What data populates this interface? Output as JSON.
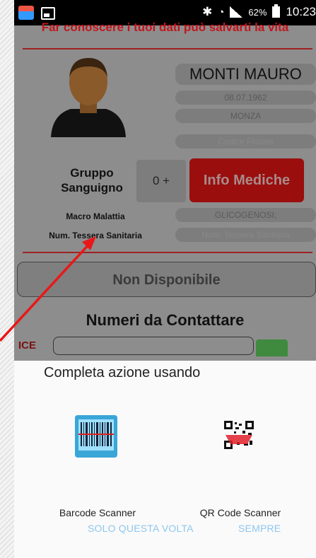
{
  "status_bar": {
    "battery": "62%",
    "time": "10:23"
  },
  "app": {
    "tagline": "Far conoscere i tuoi dati può salvarti la vita",
    "name": "MONTI MAURO",
    "birth_date": "08.07.1962",
    "city": "MONZA",
    "codice_fiscale_placeholder": "Codice Fiscale",
    "gruppo_label": "Gruppo Sanguigno",
    "blood_group": "0 +",
    "info_button": "Info Mediche",
    "macro_label": "Macro Malattia",
    "macro_value": "GLICOGENOSI;",
    "tessera_label": "Num. Tessera Sanitaria",
    "tessera_placeholder": "Num. Tessera Sanitaria",
    "non_disponibile": "Non Disponibile",
    "numeri_title": "Numeri da Contattare",
    "sos_label": "ICE"
  },
  "sheet": {
    "title": "Completa azione usando",
    "options": [
      {
        "label": "Barcode Scanner",
        "icon": "barcode-icon"
      },
      {
        "label": "QR Code Scanner",
        "icon": "qr-code-icon"
      }
    ],
    "once_button": "SOLO QUESTA VOLTA",
    "always_button": "SEMPRE"
  },
  "colors": {
    "accent_red": "#c0161c",
    "action_text": "#8ec7ee"
  }
}
